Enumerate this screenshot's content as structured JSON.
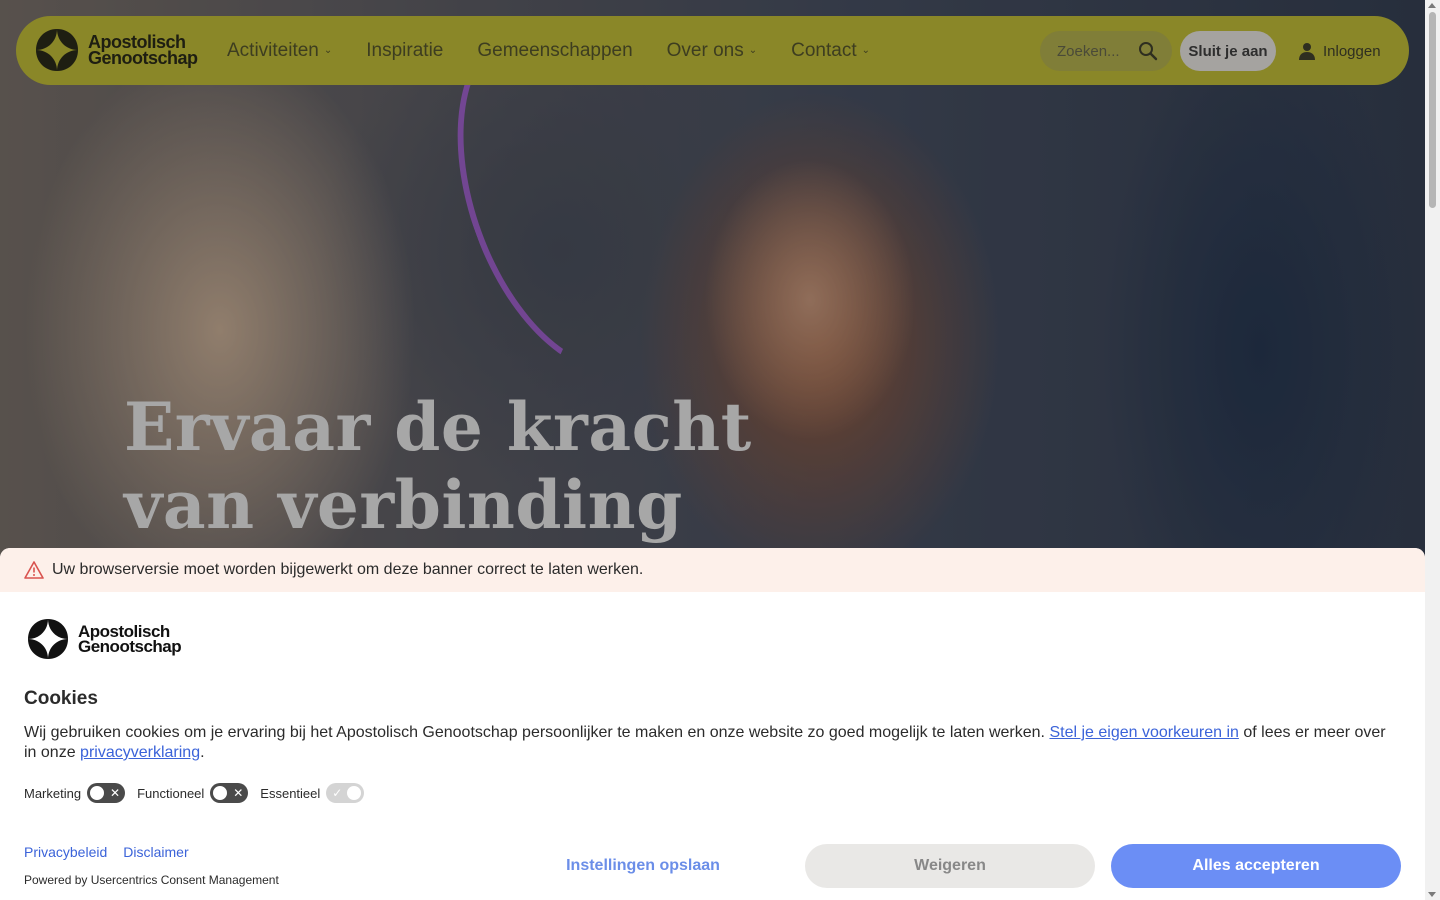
{
  "header": {
    "logo_line1": "Apostolisch",
    "logo_line2": "Genootschap",
    "nav": [
      {
        "label": "Activiteiten",
        "has_dropdown": true
      },
      {
        "label": "Inspiratie",
        "has_dropdown": false
      },
      {
        "label": "Gemeenschappen",
        "has_dropdown": false
      },
      {
        "label": "Over ons",
        "has_dropdown": true
      },
      {
        "label": "Contact",
        "has_dropdown": true
      }
    ],
    "search_placeholder": "Zoeken...",
    "join_label": "Sluit je aan",
    "login_label": "Inloggen",
    "accent_color": "#8a8728"
  },
  "hero": {
    "title_line1": "Ervaar de kracht",
    "title_line2": "van verbinding"
  },
  "cookie": {
    "warning": "Uw browserversie moet worden bijgewerkt om deze banner correct te laten werken.",
    "logo_line1": "Apostolisch",
    "logo_line2": "Genootschap",
    "title": "Cookies",
    "text_before": "Wij gebruiken cookies om je ervaring bij het Apostolisch Genootschap persoonlijker te maken en onze website zo goed mogelijk te laten werken. ",
    "link_preferences": "Stel je eigen voorkeuren in",
    "text_middle": " of lees er meer over in onze ",
    "link_privacy": "privacyverklaring",
    "text_end": ".",
    "toggles": [
      {
        "label": "Marketing",
        "enabled": false
      },
      {
        "label": "Functioneel",
        "enabled": false
      },
      {
        "label": "Essentieel",
        "enabled": true
      }
    ],
    "footer_links": [
      "Privacybeleid",
      "Disclaimer"
    ],
    "powered_by": "Powered by Usercentrics Consent Management",
    "save_label": "Instellingen opslaan",
    "deny_label": "Weigeren",
    "accept_label": "Alles accepteren",
    "link_color": "#3b63d9",
    "accept_color": "#6b8ef5"
  }
}
